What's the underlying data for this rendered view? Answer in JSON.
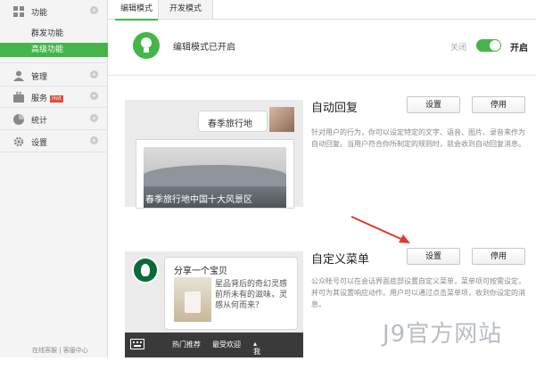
{
  "sidebar": {
    "groups": [
      {
        "label": "功能",
        "icon": "grid-icon",
        "items": [
          {
            "label": "群发功能"
          },
          {
            "label": "高级功能",
            "active": true
          }
        ]
      },
      {
        "label": "管理",
        "icon": "user-icon"
      },
      {
        "label": "服务",
        "icon": "briefcase-icon",
        "badge": "Hot"
      },
      {
        "label": "统计",
        "icon": "pie-chart-icon"
      },
      {
        "label": "设置",
        "icon": "gear-icon"
      }
    ],
    "footer": "在线客服 | 客服中心"
  },
  "tabs": [
    {
      "label": "编辑模式",
      "active": true
    },
    {
      "label": "开发模式",
      "active": false
    }
  ],
  "mode_banner": {
    "text": "编辑模式已开启",
    "off_label": "关闭",
    "on_label": "开启",
    "enabled": true
  },
  "auto_reply": {
    "title": "自动回复",
    "set_button": "设置",
    "stop_button": "停用",
    "description": "针对用户的行为，你可以设定特定的文字、语音、图片、录音来作为自动回复。当用户符合你所制定的规则时，就会收到自动回复消息。",
    "preview": {
      "bubble": "春季旅行地",
      "card_caption": "春季旅行地中国十大风景区"
    }
  },
  "custom_menu": {
    "title": "自定义菜单",
    "set_button": "设置",
    "stop_button": "停用",
    "description": "公众帐号可以在会话界面底部设置自定义菜单，菜单项可按需设定，并可为其设置响应动作。用户可以通过点击菜单项，收到你设定的消息。",
    "preview": {
      "title": "分享一个宝贝",
      "text": "星品背后的奇幻灵感前所未有的滋味，灵感从何而来？",
      "menu_items": [
        "热门推荐",
        "最受欢迎",
        "我的收藏"
      ]
    }
  },
  "watermark": "J9官方网站",
  "colors": {
    "accent": "#44b549",
    "arrow": "#e03a30"
  }
}
